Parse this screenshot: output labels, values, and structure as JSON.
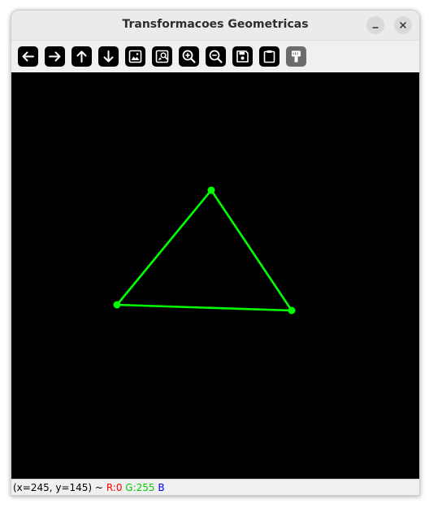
{
  "window": {
    "title": "Transformacoes Geometricas"
  },
  "titlebar_buttons": [
    {
      "name": "minimize",
      "icon": "minimize-icon"
    },
    {
      "name": "close",
      "icon": "close-icon"
    }
  ],
  "toolbar": {
    "tools": [
      {
        "icon": "arrow-left-icon",
        "enabled": true
      },
      {
        "icon": "arrow-right-icon",
        "enabled": true
      },
      {
        "icon": "arrow-up-icon",
        "enabled": true
      },
      {
        "icon": "arrow-down-icon",
        "enabled": true
      },
      {
        "icon": "image-icon",
        "enabled": true
      },
      {
        "icon": "image-search-icon",
        "enabled": true
      },
      {
        "icon": "zoom-in-icon",
        "enabled": true
      },
      {
        "icon": "zoom-out-icon",
        "enabled": true
      },
      {
        "icon": "save-icon",
        "enabled": true
      },
      {
        "icon": "clipboard-icon",
        "enabled": true
      },
      {
        "icon": "properties-icon",
        "enabled": false
      }
    ]
  },
  "canvas": {
    "background": "#000000",
    "shape": {
      "type": "triangle",
      "color": "#00ff00",
      "vertices": [
        {
          "label": "top"
        },
        {
          "label": "left"
        },
        {
          "label": "right"
        }
      ]
    }
  },
  "status": {
    "coords": "(x=245, y=145) ~",
    "r": "R:0",
    "g": "G:255",
    "b": "B",
    "r_color": "#ff0000",
    "g_color": "#00cc00",
    "b_color": "#0000ff"
  }
}
